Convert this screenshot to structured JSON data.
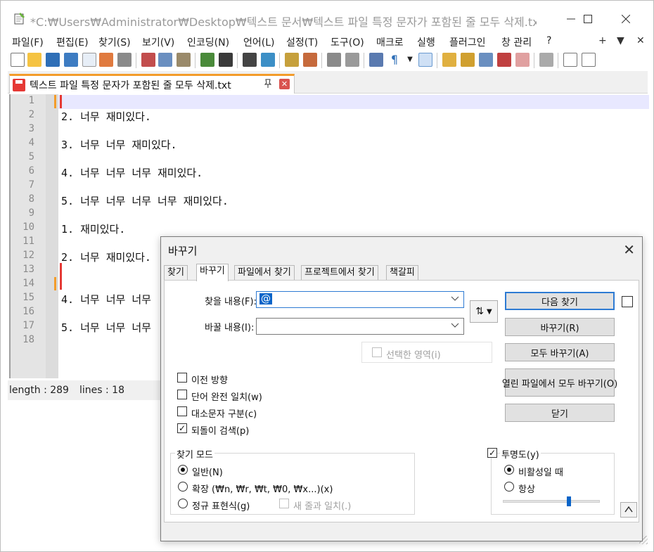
{
  "window": {
    "title": "*C:₩Users₩Administrator₩Desktop₩텍스트 문서₩텍스트 파일 특정 문자가 포함된 줄 모두 삭제.txt - N..."
  },
  "menu": [
    {
      "label": "파일(F)"
    },
    {
      "label": "편집(E)"
    },
    {
      "label": "찾기(S)"
    },
    {
      "label": "보기(V)"
    },
    {
      "label": "인코딩(N)"
    },
    {
      "label": "언어(L)"
    },
    {
      "label": "설정(T)"
    },
    {
      "label": "도구(O)"
    },
    {
      "label": "매크로"
    },
    {
      "label": "실행"
    },
    {
      "label": "플러그인"
    },
    {
      "label": "창 관리"
    },
    {
      "label": "?"
    }
  ],
  "menu_right": {
    "plus": "+",
    "down": "▼",
    "close": "✕"
  },
  "tab": {
    "label": "텍스트 파일 특정 문자가 포함된 줄 모두 삭제.txt",
    "pin": "📌",
    "close": "✕"
  },
  "editor": {
    "line_numbers": [
      "1",
      "2",
      "3",
      "4",
      "5",
      "6",
      "7",
      "8",
      "9",
      "10",
      "11",
      "12",
      "13",
      "14",
      "15",
      "16",
      "17",
      "18"
    ],
    "lines": [
      "",
      "2. 너무 재미있다.",
      "",
      "3. 너무 너무 재미있다.",
      "",
      "4. 너무 너무 너무 재미있다.",
      "",
      "5. 너무 너무 너무 너무 재미있다.",
      "",
      "1. 재미있다.",
      "",
      "2. 너무 재미있다.",
      "",
      "",
      "4. 너무 너무 너무",
      "",
      "5. 너무 너무 너무",
      ""
    ]
  },
  "status": {
    "length": "length : 289",
    "lines": "lines : 18"
  },
  "dialog": {
    "title": "바꾸기",
    "close": "✕",
    "tabs": [
      {
        "label": "찾기"
      },
      {
        "label": "바꾸기"
      },
      {
        "label": "파일에서 찾기"
      },
      {
        "label": "프로젝트에서 찾기"
      },
      {
        "label": "책갈피"
      }
    ],
    "find_label": "찾을 내용(F):",
    "find_value": "@",
    "replace_label": "바꿀 내용(I):",
    "replace_value": "",
    "swap": "⇅",
    "swap_caret": "▼",
    "in_selection": "선택한 영역(i)",
    "buttons": {
      "find_next": "다음 찾기",
      "replace": "바꾸기(R)",
      "replace_all": "모두 바꾸기(A)",
      "replace_all_open": "열린 파일에서 모두 바꾸기(O)",
      "close": "닫기"
    },
    "options": [
      {
        "label": "이전 방향",
        "checked": false
      },
      {
        "label": "단어 완전 일치(w)",
        "checked": false
      },
      {
        "label": "대소문자 구분(c)",
        "checked": false
      },
      {
        "label": "되돌이 검색(p)",
        "checked": true
      }
    ],
    "search_mode": {
      "title": "찾기 모드",
      "normal": "일반(N)",
      "extended": "확장 (₩n, ₩r, ₩t, ₩0, ₩x...)(x)",
      "regex": "정규 표현식(g)",
      "newline": "새 줄과 일치(.)",
      "selected": "normal"
    },
    "transparency": {
      "title": "투명도(y)",
      "checked": true,
      "on_lose_focus": "비활성일 때",
      "always": "항상",
      "selected": "on_lose_focus",
      "level": 0.68
    },
    "collapse": "^",
    "checkmark": "✓"
  },
  "colors": {
    "accent": "#2e7bd3",
    "tab_top": "#f39c2a",
    "marker_red": "#e53935",
    "marker_orange": "#f39c2a"
  }
}
